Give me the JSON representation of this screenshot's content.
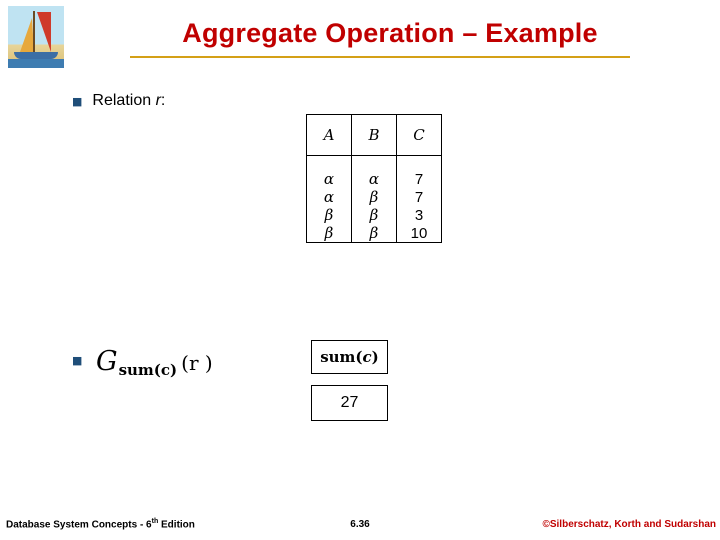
{
  "slide": {
    "title": "Aggregate Operation – Example",
    "logo_alt": "sailboat-logo",
    "bullets": [
      {
        "marker": "n",
        "text_prefix": "Relation ",
        "text_italic": "r",
        "text_suffix": ":"
      }
    ],
    "relation_table": {
      "headers": [
        "A",
        "B",
        "C"
      ],
      "rows": [
        [
          "α",
          "α",
          "7"
        ],
        [
          "α",
          "β",
          "7"
        ],
        [
          "β",
          "β",
          "3"
        ],
        [
          "β",
          "β",
          "10"
        ]
      ]
    },
    "aggregate_expression": {
      "operator": "G",
      "subscript": "sum(c)",
      "argument": "(r )"
    },
    "result_table": {
      "header_bold": "sum(",
      "header_italic": "c",
      "header_tail": " )",
      "header_full": "sum(c )",
      "value": "27"
    },
    "footer": {
      "left_text": "Database System Concepts - 6",
      "left_sup": "th",
      "left_tail": " Edition",
      "center": "6.36",
      "right": "©Silberschatz, Korth and Sudarshan"
    },
    "colors": {
      "title": "#c00000",
      "title_rule": "#d4a017",
      "bullet_marker": "#1f4e79",
      "footer_right": "#c00000"
    }
  }
}
